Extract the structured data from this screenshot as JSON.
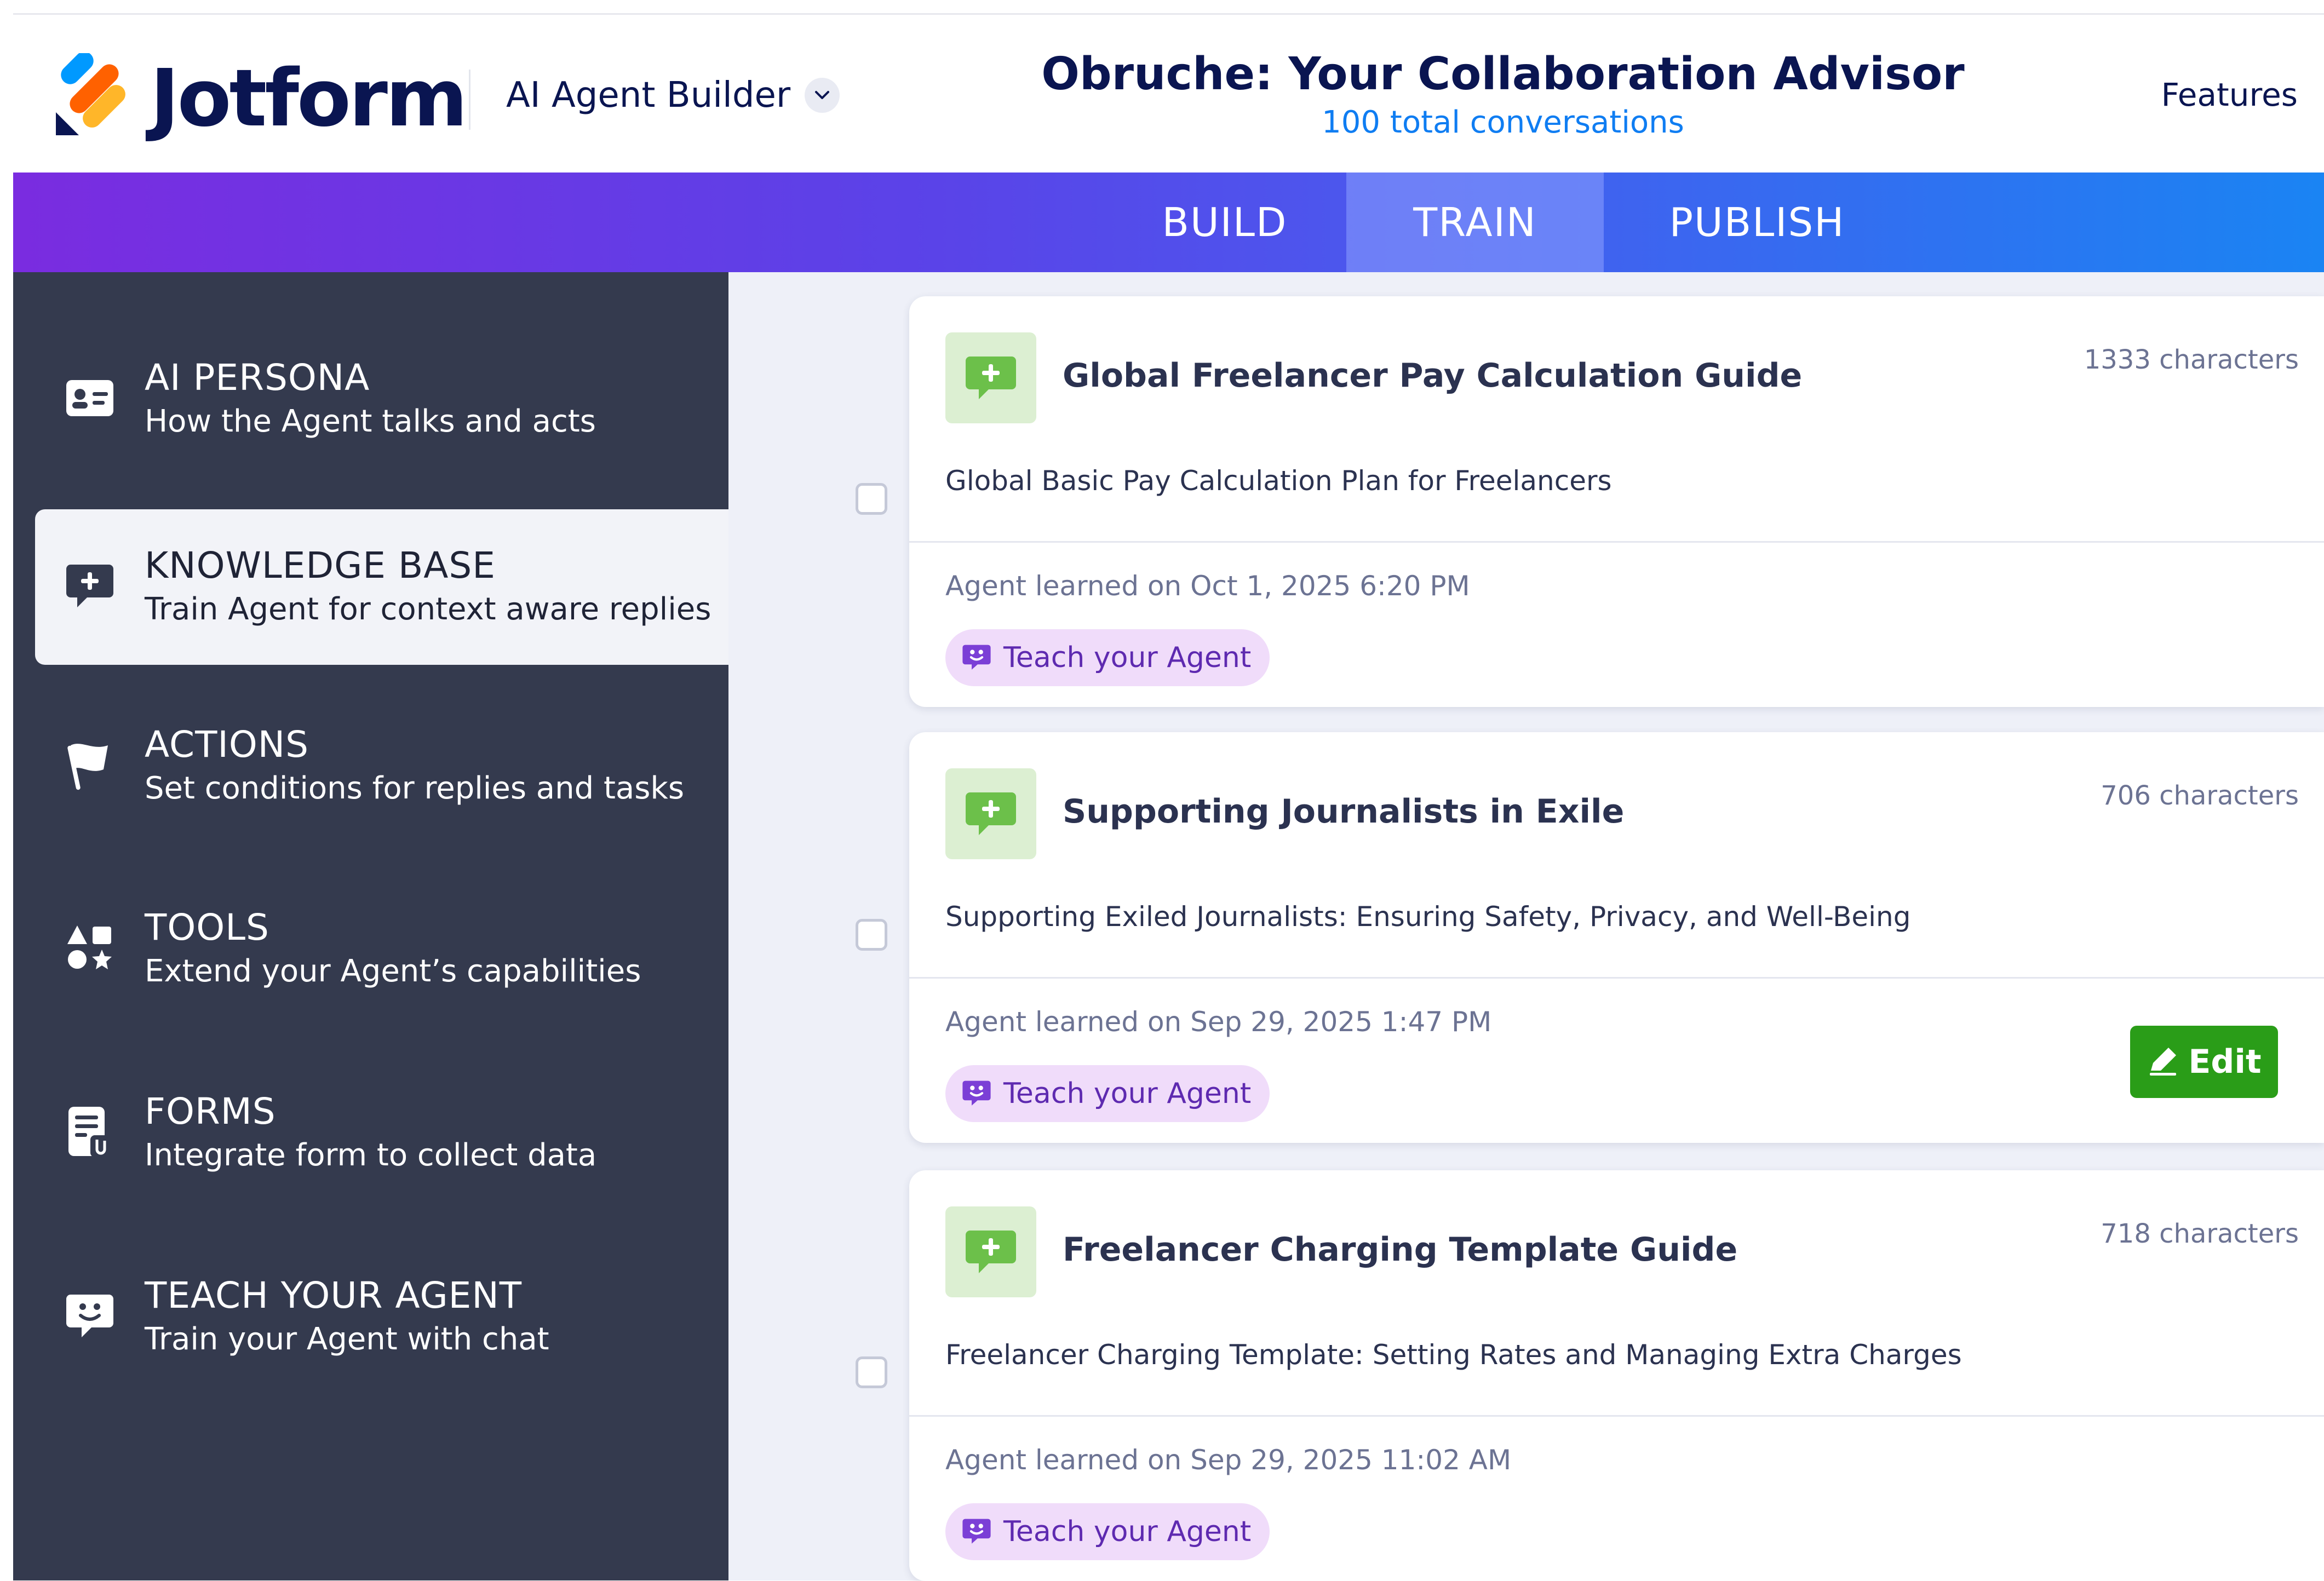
{
  "header": {
    "logo_text": "Jotform",
    "builder_label": "AI Agent Builder",
    "agent_name": "Obruche: Your Collaboration Advisor",
    "conversations": "100 total conversations",
    "features_label": "Features"
  },
  "tabs": [
    {
      "label": "BUILD",
      "active": false
    },
    {
      "label": "TRAIN",
      "active": true
    },
    {
      "label": "PUBLISH",
      "active": false
    }
  ],
  "sidebar": {
    "items": [
      {
        "title": "AI PERSONA",
        "subtitle": "How the Agent talks and acts",
        "icon": "id-card-icon",
        "active": false
      },
      {
        "title": "KNOWLEDGE BASE",
        "subtitle": "Train Agent for context aware replies",
        "icon": "chat-plus-icon",
        "active": true
      },
      {
        "title": "ACTIONS",
        "subtitle": "Set conditions for replies and tasks",
        "icon": "flag-icon",
        "active": false
      },
      {
        "title": "TOOLS",
        "subtitle": "Extend your Agent’s capabilities",
        "icon": "shapes-icon",
        "active": false
      },
      {
        "title": "FORMS",
        "subtitle": "Integrate form to collect data",
        "icon": "form-icon",
        "active": false
      },
      {
        "title": "TEACH YOUR AGENT",
        "subtitle": "Train your Agent with chat",
        "icon": "smile-chat-icon",
        "active": false
      }
    ]
  },
  "cards": [
    {
      "title": "Global Freelancer Pay Calculation Guide",
      "chars": "1333 characters",
      "description": "Global Basic Pay Calculation Plan for Freelancers",
      "learned": "Agent learned on Oct 1, 2025 6:20 PM",
      "teach_label": "Teach your Agent"
    },
    {
      "title": "Supporting Journalists in Exile",
      "chars": "706 characters",
      "description": "Supporting Exiled Journalists: Ensuring Safety, Privacy, and Well-Being",
      "learned": "Agent learned on Sep 29, 2025 1:47 PM",
      "teach_label": "Teach your Agent",
      "edit_label": "Edit"
    },
    {
      "title": "Freelancer Charging Template Guide",
      "chars": "718 characters",
      "description": "Freelancer Charging Template: Setting Rates and Managing Extra Charges",
      "learned": "Agent learned on Sep 29, 2025 11:02 AM",
      "teach_label": "Teach your Agent"
    }
  ],
  "colors": {
    "brand_navy": "#0a1551",
    "sidebar_bg": "#343a4e",
    "accent_blue": "#0f7df2",
    "kb_green": "#6cc04a",
    "edit_green": "#2a9d18",
    "teach_purple": "#5e2ab0"
  }
}
